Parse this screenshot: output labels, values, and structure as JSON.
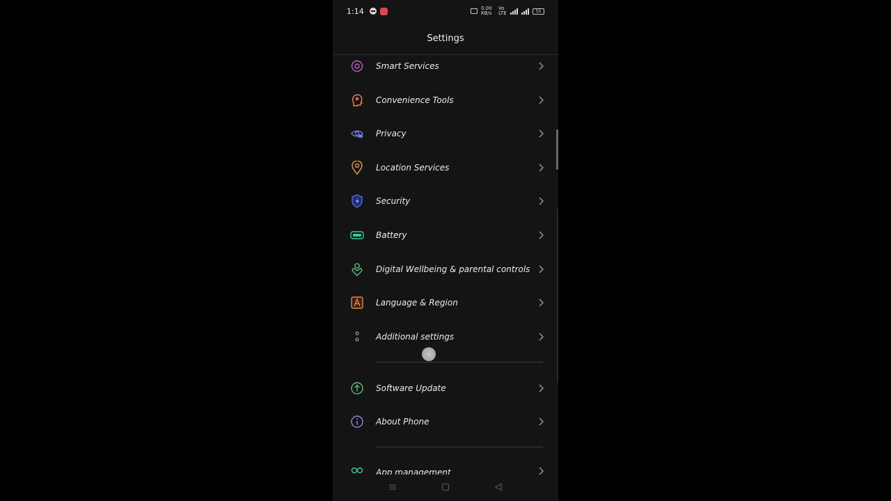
{
  "status_bar": {
    "time": "1:14",
    "net_speed": "0.00 KB/s",
    "net_gen": "Vo LTE",
    "battery": "55"
  },
  "header": {
    "title": "Settings"
  },
  "menu": {
    "items": [
      {
        "label": "Smart Services",
        "icon": "smart-services-icon",
        "color": "#c060c0"
      },
      {
        "label": "Convenience Tools",
        "icon": "convenience-tools-icon",
        "color": "#e8864a"
      },
      {
        "label": "Privacy",
        "icon": "privacy-icon",
        "color": "#6a7bd8"
      },
      {
        "label": "Location Services",
        "icon": "location-icon",
        "color": "#e8a04a"
      },
      {
        "label": "Security",
        "icon": "security-icon",
        "color": "#4a6ae8"
      },
      {
        "label": "Battery",
        "icon": "battery-icon",
        "color": "#3ac8a0"
      },
      {
        "label": "Digital Wellbeing & parental controls",
        "icon": "wellbeing-icon",
        "color": "#5ac070"
      },
      {
        "label": "Language & Region",
        "icon": "language-icon",
        "color": "#e8864a"
      },
      {
        "label": "Additional settings",
        "icon": "additional-settings-icon",
        "color": "#9a9a9a"
      },
      {
        "label": "Software Update",
        "icon": "software-update-icon",
        "color": "#5ac070"
      },
      {
        "label": "About Phone",
        "icon": "about-phone-icon",
        "color": "#8a8ae0"
      },
      {
        "label": "App management",
        "icon": "app-management-icon",
        "color": "#3ac8a0"
      }
    ]
  },
  "navigation_bar": {
    "buttons": [
      "menu-icon",
      "home-icon",
      "back-icon"
    ]
  }
}
